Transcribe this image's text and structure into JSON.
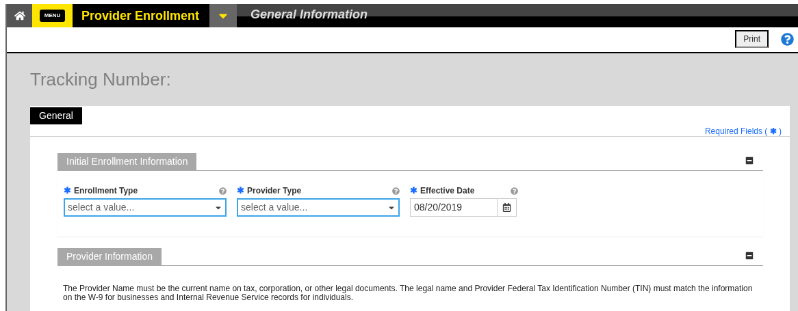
{
  "header": {
    "menu_label": "MENU",
    "app_title": "Provider Enrollment",
    "page_title": "General Information"
  },
  "toolbar": {
    "print_label": "Print"
  },
  "tracking": {
    "label": "Tracking Number:"
  },
  "tabs": [
    {
      "label": "General",
      "selected": true
    }
  ],
  "required_note": {
    "text": "Required Fields (",
    "mark": "✱",
    "close": ")"
  },
  "sections": [
    {
      "title": "Initial Enrollment Information",
      "expanded": true,
      "fields": [
        {
          "kind": "select",
          "label": "Enrollment Type",
          "required": true,
          "placeholder": "select a value..."
        },
        {
          "kind": "select",
          "label": "Provider Type",
          "required": true,
          "placeholder": "select a value..."
        },
        {
          "kind": "date",
          "label": "Effective Date",
          "required": true,
          "value": "08/20/2019"
        }
      ]
    },
    {
      "title": "Provider Information",
      "expanded": true,
      "text": "The Provider Name must be the current name on tax, corporation, or other legal documents. The legal name and Provider Federal Tax Identification Number (TIN) must match the information on the W-9 for businesses and Internal Revenue Service records for individuals."
    }
  ]
}
